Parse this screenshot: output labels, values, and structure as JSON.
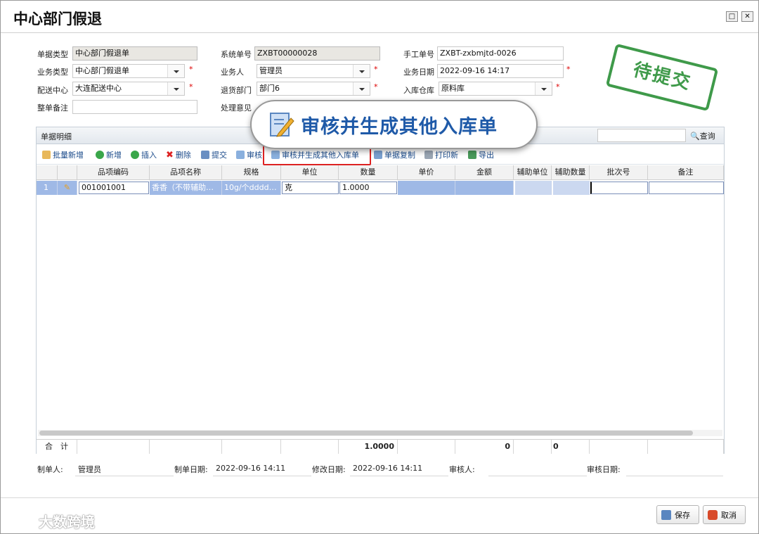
{
  "window": {
    "title": "中心部门假退",
    "maximize_icon": "maximize-icon",
    "close_icon": "close-icon"
  },
  "form": {
    "doc_type": {
      "label": "单据类型",
      "value": "中心部门假退单"
    },
    "system_no": {
      "label": "系统单号",
      "value": "ZXBT00000028"
    },
    "manual_no": {
      "label": "手工单号",
      "value": "ZXBT-zxbmjtd-0026"
    },
    "business_type": {
      "label": "业务类型",
      "value": "中心部门假退单"
    },
    "handler": {
      "label": "业务人",
      "value": "管理员"
    },
    "business_date": {
      "label": "业务日期",
      "value": "2022-09-16 14:17"
    },
    "distribution_center": {
      "label": "配送中心",
      "value": "大连配送中心"
    },
    "return_dept": {
      "label": "退货部门",
      "value": "部门6"
    },
    "warehouse": {
      "label": "入库仓库",
      "value": "原料库"
    },
    "remark": {
      "label": "整单备注",
      "value": ""
    },
    "opinion": {
      "label": "处理意见"
    },
    "required_mark": "*"
  },
  "stamp": "待提交",
  "detail": {
    "title": "单据明细",
    "search_placeholder": "",
    "search_label": "查询",
    "toolbar": [
      "批量新增",
      "新增",
      "插入",
      "删除",
      "提交",
      "审核",
      "审核并生成其他入库单",
      "单据复制",
      "打印新",
      "导出"
    ],
    "columns": [
      "",
      "",
      "品项编码",
      "品项名称",
      "规格",
      "单位",
      "数量",
      "单价",
      "金额",
      "辅助单位",
      "辅助数量",
      "批次号",
      "备注"
    ],
    "rows": [
      {
        "no": "1",
        "code": "001001001",
        "name": "香香（不带辅助…",
        "spec": "10g/个dddd…",
        "unit": "克",
        "qty": "1.0000",
        "price": "",
        "amount": "",
        "aux_unit": "",
        "aux_qty": "",
        "batch": "",
        "note": ""
      }
    ],
    "totals": {
      "label": "合　计",
      "qty": "1.0000",
      "amount": "0",
      "aux_qty": "0"
    }
  },
  "callout": "审核并生成其他入库单",
  "footer": {
    "creator_label": "制单人:",
    "creator": "管理员",
    "create_date_label": "制单日期:",
    "create_date": "2022-09-16 14:11",
    "modify_date_label": "修改日期:",
    "modify_date": "2022-09-16 14:11",
    "auditor_label": "审核人:",
    "auditor": "",
    "audit_date_label": "审核日期:",
    "audit_date": ""
  },
  "buttons": {
    "save": "保存",
    "cancel": "取消"
  },
  "watermark": "大数跨境"
}
